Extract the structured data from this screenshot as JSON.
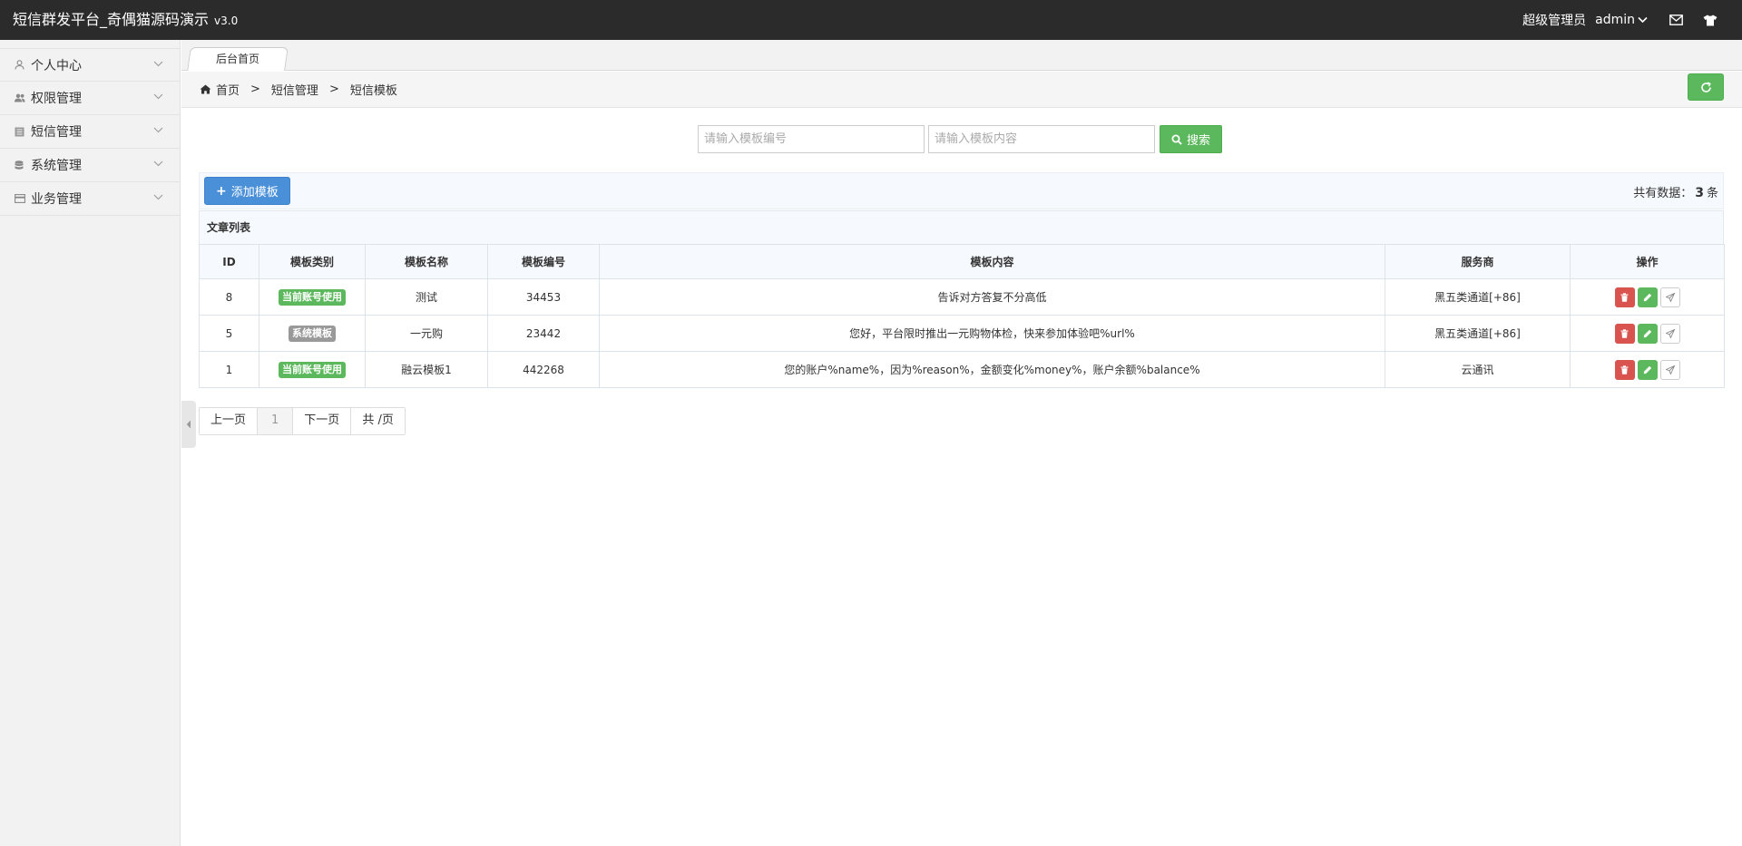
{
  "header": {
    "title": "短信群发平台_奇偶猫源码演示",
    "version": "v3.0",
    "role": "超级管理员",
    "username": "admin",
    "icons": [
      "mail-icon",
      "shirt-icon"
    ]
  },
  "sidebar": {
    "items": [
      {
        "label": "个人中心",
        "icon": "user-icon"
      },
      {
        "label": "权限管理",
        "icon": "users-icon"
      },
      {
        "label": "短信管理",
        "icon": "list-icon"
      },
      {
        "label": "系统管理",
        "icon": "database-icon"
      },
      {
        "label": "业务管理",
        "icon": "card-icon"
      }
    ]
  },
  "tabs": [
    {
      "label": "后台首页"
    }
  ],
  "breadcrumb": [
    "首页",
    "短信管理",
    "短信模板"
  ],
  "breadcrumb_sep": ">",
  "search": {
    "code_placeholder": "请输入模板编号",
    "content_placeholder": "请输入模板内容",
    "button_label": "搜索"
  },
  "toolbar": {
    "add_label": "添加模板",
    "total_prefix": "共有数据：",
    "total_count": "3",
    "total_suffix": "条"
  },
  "table": {
    "title": "文章列表",
    "columns": [
      "ID",
      "模板类别",
      "模板名称",
      "模板编号",
      "模板内容",
      "服务商",
      "操作"
    ],
    "rows": [
      {
        "id": "8",
        "category": "当前账号使用",
        "category_color": "#5cb85c",
        "name": "测试",
        "code": "34453",
        "content": "告诉对方答复不分高低",
        "provider": "黑五类通道[+86]"
      },
      {
        "id": "5",
        "category": "系统模板",
        "category_color": "#999999",
        "name": "一元购",
        "code": "23442",
        "content": "您好，平台限时推出一元购物体检，快来参加体验吧%url%",
        "provider": "黑五类通道[+86]"
      },
      {
        "id": "1",
        "category": "当前账号使用",
        "category_color": "#5cb85c",
        "name": "融云模板1",
        "code": "442268",
        "content": "您的账户%name%，因为%reason%，金额变化%money%，账户余额%balance%",
        "provider": "云通讯"
      }
    ]
  },
  "pagination": {
    "prev": "上一页",
    "current": "1",
    "next": "下一页",
    "total": "共 /页"
  },
  "colors": {
    "topbar": "#2b2b2b",
    "success": "#5cb85c",
    "primary": "#4a90d9",
    "danger": "#d9534f"
  }
}
